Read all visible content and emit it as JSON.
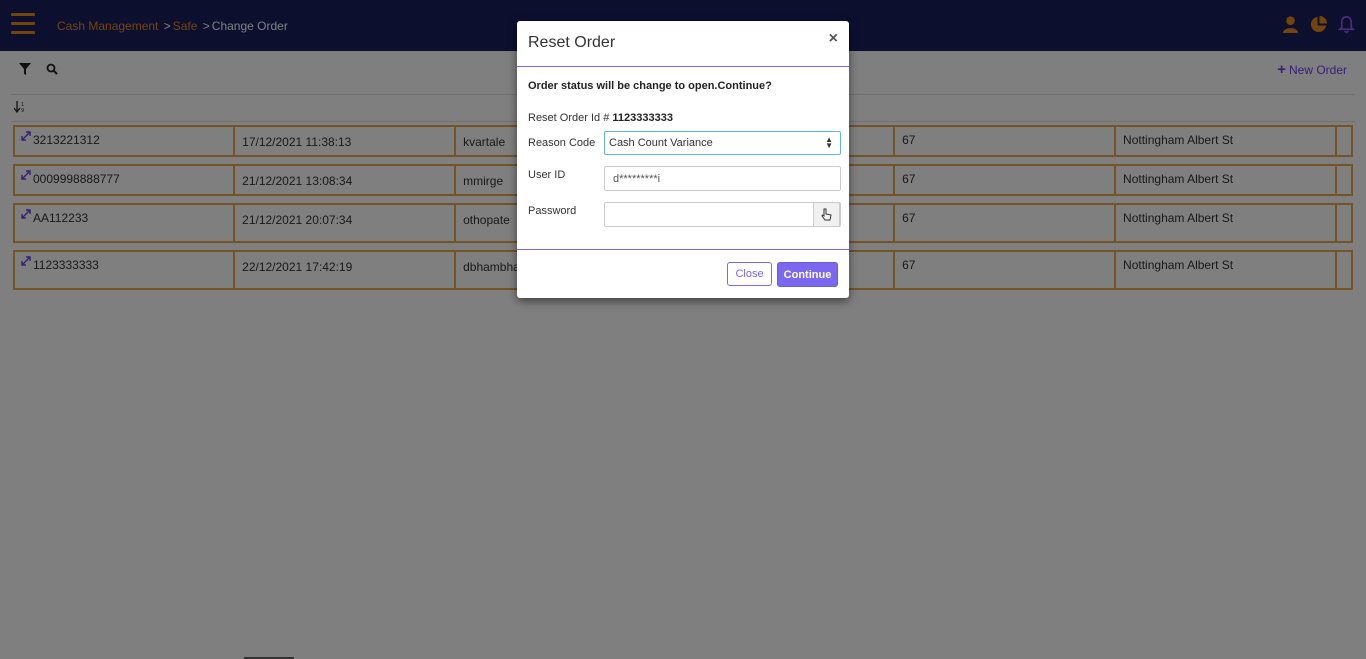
{
  "colors": {
    "header_bg": "#1a1f5e",
    "accent_orange": "#e8891e",
    "accent_purple": "#6c3ff0",
    "row_border": "#e8a84a"
  },
  "breadcrumb": {
    "items": [
      "Cash Management",
      "Safe",
      "Change Order"
    ],
    "separator": ">"
  },
  "header": {
    "icons": [
      "user-icon",
      "pie-chart-icon",
      "bell-icon"
    ]
  },
  "toolbar": {
    "new_order_label": "New Order"
  },
  "table": {
    "rows": [
      {
        "order_id": "3213221312",
        "datetime": "17/12/2021 11:38:13",
        "user": "kvartale",
        "code_suffix": "67",
        "location": "Nottingham Albert St",
        "has_actions": false
      },
      {
        "order_id": "0009998888777",
        "datetime": "21/12/2021 13:08:34",
        "user": "mmirge",
        "code_suffix": "67",
        "location": "Nottingham Albert St",
        "has_actions": false
      },
      {
        "order_id": "AA112233",
        "datetime": "21/12/2021 20:07:34",
        "user": "othopate",
        "code_suffix": "67",
        "location": "Nottingham Albert St",
        "has_actions": true
      },
      {
        "order_id": "1123333333",
        "datetime": "22/12/2021 17:42:19",
        "user": "dbhambha",
        "code_suffix": "67",
        "location": "Nottingham Albert St",
        "has_actions": true
      }
    ]
  },
  "modal": {
    "title": "Reset Order",
    "close_symbol": "×",
    "message": "Order status will be change to open.Continue?",
    "reset_id_label": "Reset Order Id #",
    "reset_id_value": "1123333333",
    "reason_code_label": "Reason Code",
    "reason_code_value": "Cash Count Variance",
    "user_id_label": "User ID",
    "user_id_value": "d*********i",
    "password_label": "Password",
    "password_value": "",
    "close_button": "Close",
    "continue_button": "Continue"
  }
}
